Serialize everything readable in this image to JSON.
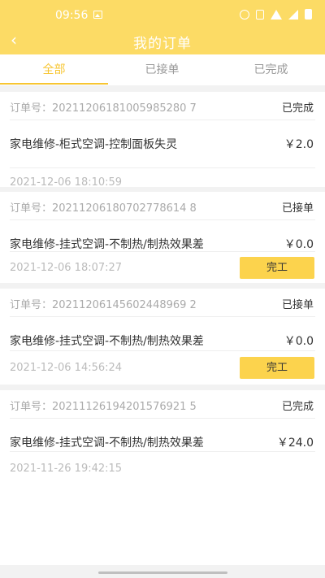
{
  "status_bar": {
    "time": "09:56"
  },
  "header": {
    "title": "我的订单"
  },
  "tabs": [
    {
      "label": "全部",
      "active": true
    },
    {
      "label": "已接单",
      "active": false
    },
    {
      "label": "已完成",
      "active": false
    }
  ],
  "orders": [
    {
      "order_no": "订单号：20211206181005985280 7",
      "status": "已完成",
      "service": "家电维修-柜式空调-控制面板失灵",
      "price": "￥2.0",
      "time": "2021-12-06 18:10:59",
      "action": null
    },
    {
      "order_no": "订单号：20211206180702778614 8",
      "status": "已接单",
      "service": "家电维修-挂式空调-不制热/制热效果差",
      "price": "￥0.0",
      "time": "2021-12-06 18:07:27",
      "action": "完工"
    },
    {
      "order_no": "订单号：20211206145602448969 2",
      "status": "已接单",
      "service": "家电维修-挂式空调-不制热/制热效果差",
      "price": "￥0.0",
      "time": "2021-12-06 14:56:24",
      "action": "完工"
    },
    {
      "order_no": "订单号：20211126194201576921 5",
      "status": "已完成",
      "service": "家电维修-挂式空调-不制热/制热效果差",
      "price": "￥24.0",
      "time": "2021-11-26 19:42:15",
      "action": null
    }
  ]
}
